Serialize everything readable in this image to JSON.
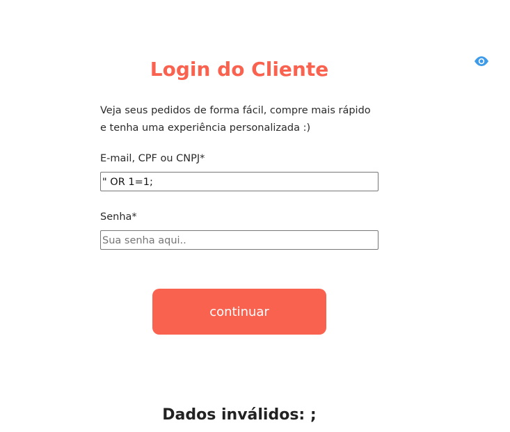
{
  "login": {
    "title": "Login do Cliente",
    "intro_line1": "Veja seus pedidos de forma fácil, compre mais rápido",
    "intro_line2": "e tenha uma experiência personalizada :)",
    "email_label": "E-mail, CPF ou CNPJ*",
    "email_value": "\" OR 1=1;",
    "password_label": "Senha*",
    "password_placeholder": "Sua senha aqui..",
    "continue_label": "continuar",
    "error_message": "Dados inválidos: ;"
  },
  "icons": {
    "toggle_visibility": "eye-icon"
  },
  "colors": {
    "accent": "#fa6250",
    "eye_icon": "#3d9be9",
    "text": "#222222"
  }
}
